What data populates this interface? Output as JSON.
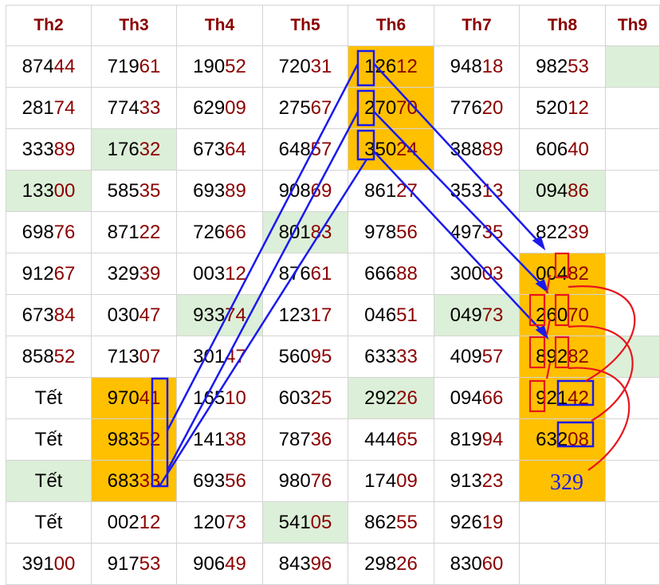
{
  "headers": [
    "Th2",
    "Th3",
    "Th4",
    "Th5",
    "Th6",
    "Th7",
    "Th8",
    "Th9"
  ],
  "rows": [
    [
      "87444",
      "71961",
      "19052",
      "72031",
      "12612",
      "94818",
      "98253",
      ""
    ],
    [
      "28174",
      "77433",
      "62909",
      "27567",
      "27070",
      "77620",
      "52012",
      ""
    ],
    [
      "33389",
      "17632",
      "67364",
      "64857",
      "35024",
      "38889",
      "60640",
      ""
    ],
    [
      "13300",
      "58535",
      "69389",
      "90869",
      "86127",
      "35313",
      "09486",
      ""
    ],
    [
      "69876",
      "87122",
      "72666",
      "80183",
      "97856",
      "49735",
      "82239",
      ""
    ],
    [
      "91267",
      "32939",
      "00312",
      "87661",
      "66688",
      "30003",
      "00482",
      ""
    ],
    [
      "67384",
      "03047",
      "93374",
      "12317",
      "04651",
      "04973",
      "26070",
      ""
    ],
    [
      "85852",
      "71307",
      "30147",
      "56095",
      "63333",
      "40957",
      "89282",
      ""
    ],
    [
      "Tết",
      "97041",
      "16510",
      "60325",
      "29226",
      "09466",
      "92142",
      ""
    ],
    [
      "Tết",
      "98352",
      "14138",
      "78736",
      "44465",
      "81994",
      "63208",
      ""
    ],
    [
      "Tết",
      "68333",
      "69356",
      "98076",
      "17409",
      "91323",
      "",
      ""
    ],
    [
      "Tết",
      "00212",
      "12073",
      "54105",
      "86255",
      "92619",
      "",
      ""
    ],
    [
      "39100",
      "91753",
      "90649",
      "84396",
      "29826",
      "83060",
      "",
      ""
    ]
  ],
  "highlights": {
    "green": [
      "0-7",
      "2-1",
      "3-0",
      "3-6",
      "4-3",
      "6-2",
      "6-5",
      "7-7",
      "8-4",
      "10-0",
      "11-3"
    ],
    "orange": [
      "0-4",
      "1-4",
      "2-4",
      "5-6",
      "6-6",
      "7-6",
      "8-6",
      "9-6",
      "10-6",
      "8-1",
      "9-1",
      "10-1"
    ]
  },
  "annotation": {
    "text": "329",
    "color_blue": "#1a1aee",
    "color_red": "#e8141c"
  }
}
